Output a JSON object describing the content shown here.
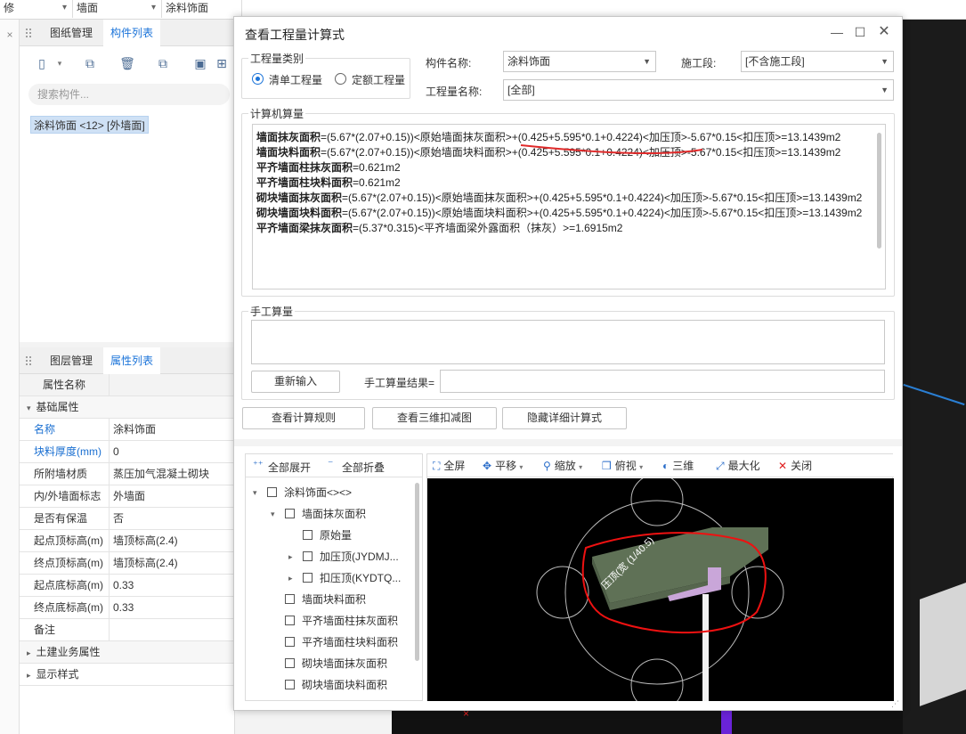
{
  "topbar": {
    "items": [
      "修",
      "墙面",
      "涂料饰面"
    ]
  },
  "component_panel": {
    "tabs": [
      "图纸管理",
      "构件列表"
    ],
    "search_placeholder": "搜索构件...",
    "selected_item": "涂料饰面 <12> [外墙面]"
  },
  "property_panel": {
    "tabs": [
      "图层管理",
      "属性列表"
    ],
    "header": "属性名称",
    "group_basic": "基础属性",
    "rows": [
      {
        "k": "名称",
        "v": "涂料饰面"
      },
      {
        "k": "块料厚度(mm)",
        "v": "0"
      },
      {
        "k": "所附墙材质",
        "v": "蒸压加气混凝土砌块"
      },
      {
        "k": "内/外墙面标志",
        "v": "外墙面"
      },
      {
        "k": "是否有保温",
        "v": "否"
      },
      {
        "k": "起点顶标高(m)",
        "v": "墙顶标高(2.4)"
      },
      {
        "k": "终点顶标高(m)",
        "v": "墙顶标高(2.4)"
      },
      {
        "k": "起点底标高(m)",
        "v": "0.33"
      },
      {
        "k": "终点底标高(m)",
        "v": "0.33"
      },
      {
        "k": "备注",
        "v": ""
      }
    ],
    "group_civil": "土建业务属性",
    "group_display": "显示样式"
  },
  "dialog": {
    "title": "查看工程量计算式",
    "category_label": "工程量类别",
    "radio_list": "清单工程量",
    "radio_quota": "定额工程量",
    "component_name_label": "构件名称:",
    "component_name_value": "涂料饰面",
    "stage_label": "施工段:",
    "stage_value": "[不含施工段]",
    "quantity_name_label": "工程量名称:",
    "quantity_name_value": "[全部]",
    "computer_label": "计算机算量",
    "calc_lines": [
      {
        "name": "墙面抹灰面积",
        "expr": "=(5.67*(2.07+0.15))<原始墙面抹灰面积>+(0.425+5.595*0.1+0.4224)<加压顶>-5.67*0.15<扣压顶>=13.1439m2"
      },
      {
        "name": "墙面块料面积",
        "expr": "=(5.67*(2.07+0.15))<原始墙面块料面积>+(0.425+5.595*0.1+0.4224)<加压顶>-5.67*0.15<扣压顶>=13.1439m2"
      },
      {
        "name": "平齐墙面柱抹灰面积",
        "expr": "=0.621m2"
      },
      {
        "name": "平齐墙面柱块料面积",
        "expr": "=0.621m2"
      },
      {
        "name": "砌块墙面抹灰面积",
        "expr": "=(5.67*(2.07+0.15))<原始墙面抹灰面积>+(0.425+5.595*0.1+0.4224)<加压顶>-5.67*0.15<扣压顶>=13.1439m2"
      },
      {
        "name": "砌块墙面块料面积",
        "expr": "=(5.67*(2.07+0.15))<原始墙面块料面积>+(0.425+5.595*0.1+0.4224)<加压顶>-5.67*0.15<扣压顶>=13.1439m2"
      },
      {
        "name": "平齐墙面梁抹灰面积",
        "expr": "=(5.37*0.315)<平齐墙面梁外露面积（抹灰）>=1.6915m2"
      }
    ],
    "manual_label": "手工算量",
    "reenter_button": "重新输入",
    "manual_result_label": "手工算量结果=",
    "view_rules_button": "查看计算规则",
    "view_3d_button": "查看三维扣减图",
    "hide_detail_button": "隐藏详细计算式",
    "tree_expand": "全部展开",
    "tree_collapse": "全部折叠",
    "tree": [
      {
        "label": "涂料饰面<><>",
        "level": 0,
        "twisty": "▾"
      },
      {
        "label": "墙面抹灰面积",
        "level": 1,
        "twisty": "▾"
      },
      {
        "label": "原始量",
        "level": 2,
        "twisty": ""
      },
      {
        "label": "加压顶(JYDMJ...",
        "level": 2,
        "twisty": "▸"
      },
      {
        "label": "扣压顶(KYDTQ...",
        "level": 2,
        "twisty": "▸"
      },
      {
        "label": "墙面块料面积",
        "level": 1,
        "twisty": ""
      },
      {
        "label": "平齐墙面柱抹灰面积",
        "level": 1,
        "twisty": ""
      },
      {
        "label": "平齐墙面柱块料面积",
        "level": 1,
        "twisty": ""
      },
      {
        "label": "砌块墙面抹灰面积",
        "level": 1,
        "twisty": ""
      },
      {
        "label": "砌块墙面块料面积",
        "level": 1,
        "twisty": ""
      }
    ],
    "viewer_tools": [
      "全屏",
      "平移",
      "缩放",
      "俯视",
      "三维",
      "最大化",
      "关闭"
    ],
    "scene_label": "压顶(宽 (1/40.5)"
  }
}
